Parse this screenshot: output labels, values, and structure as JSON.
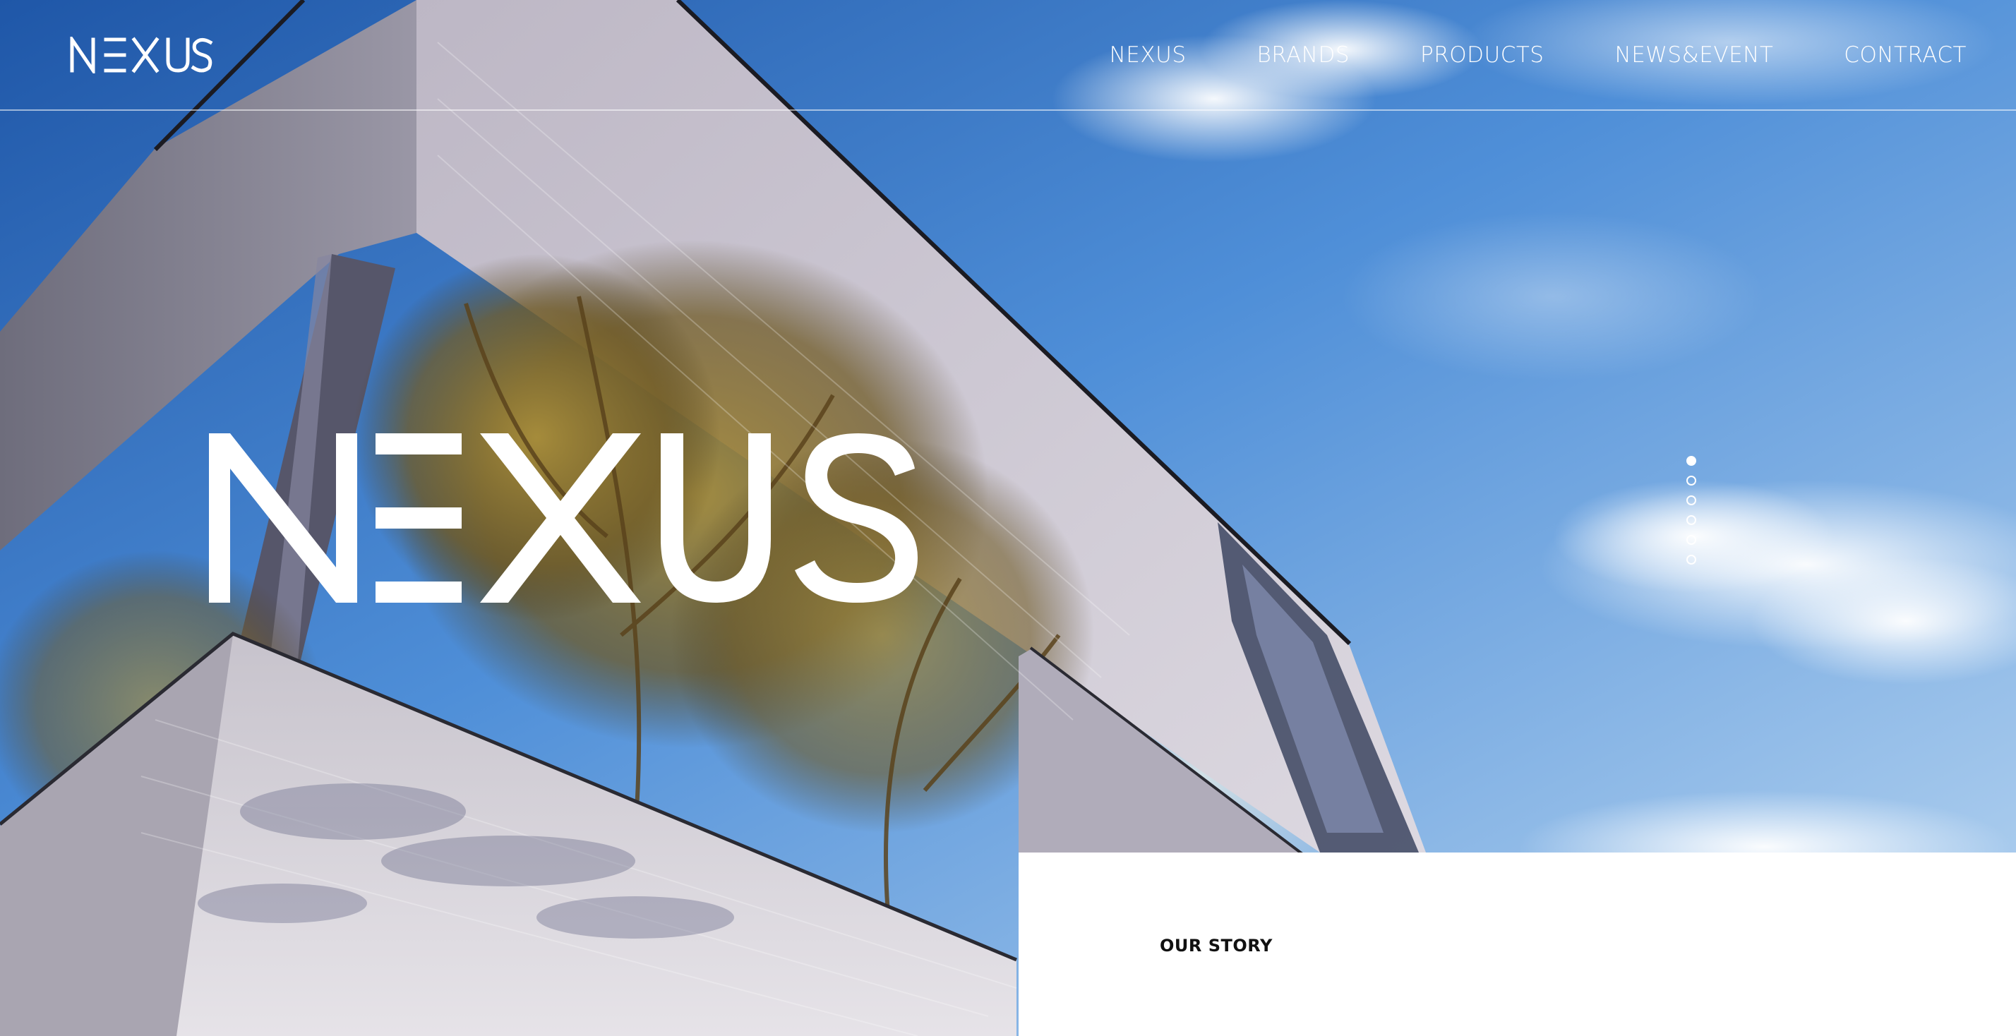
{
  "brand": {
    "logo_text": "NEXUS",
    "logo_icon": "nexus-wordmark"
  },
  "nav": {
    "items": [
      {
        "label": "NEXUS"
      },
      {
        "label": "BRANDS"
      },
      {
        "label": "PRODUCTS"
      },
      {
        "label": "NEWS&EVENT"
      },
      {
        "label": "CONTRACT"
      }
    ]
  },
  "hero": {
    "headline_logo": "NEXUS",
    "slides": {
      "count": 6,
      "active": 1
    }
  },
  "story": {
    "title": "OUR STORY"
  },
  "colors": {
    "sky_top": "#2c66b8",
    "sky_bottom": "#9cc3ea",
    "wall": "#cdc8d4",
    "panel": "#ffffff",
    "text_dark": "#111111",
    "nav_text": "#ffffff"
  }
}
